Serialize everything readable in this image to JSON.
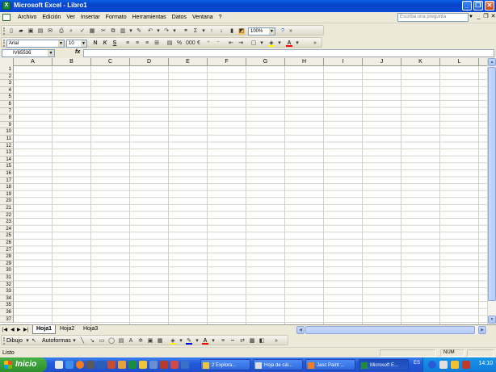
{
  "window": {
    "title": "Microsoft Excel - Libro1"
  },
  "menu": {
    "items": [
      "Archivo",
      "Edición",
      "Ver",
      "Insertar",
      "Formato",
      "Herramientas",
      "Datos",
      "Ventana",
      "?"
    ],
    "search_placeholder": "Escriba una pregunta"
  },
  "standard_toolbar": {
    "zoom": "100%"
  },
  "formatting_toolbar": {
    "font": "Arial",
    "size": "10"
  },
  "formula_bar": {
    "name_box": "IV65536",
    "fx": "fx"
  },
  "grid": {
    "columns": [
      "A",
      "B",
      "C",
      "D",
      "E",
      "F",
      "G",
      "H",
      "I",
      "J",
      "K",
      "L"
    ],
    "rows": [
      "1",
      "2",
      "3",
      "4",
      "5",
      "6",
      "7",
      "8",
      "9",
      "10",
      "11",
      "12",
      "13",
      "14",
      "15",
      "16",
      "17",
      "18",
      "19",
      "20",
      "21",
      "22",
      "23",
      "24",
      "25",
      "26",
      "27",
      "28",
      "29",
      "30",
      "31",
      "32",
      "33",
      "34",
      "35",
      "36",
      "37"
    ]
  },
  "sheets": {
    "tabs": [
      "Hoja1",
      "Hoja2",
      "Hoja3"
    ],
    "active": "Hoja1"
  },
  "drawing_toolbar": {
    "draw_label": "Dibujo",
    "autoshapes_label": "Autoformas"
  },
  "status": {
    "ready": "Listo",
    "num": "NUM"
  },
  "taskbar": {
    "start_label": "Inicio",
    "tasks": [
      "2 Explora...",
      "Hoja de cál...",
      "Jasc Paint ...",
      "Microsoft E..."
    ],
    "language": "ES",
    "clock": "14:10"
  }
}
